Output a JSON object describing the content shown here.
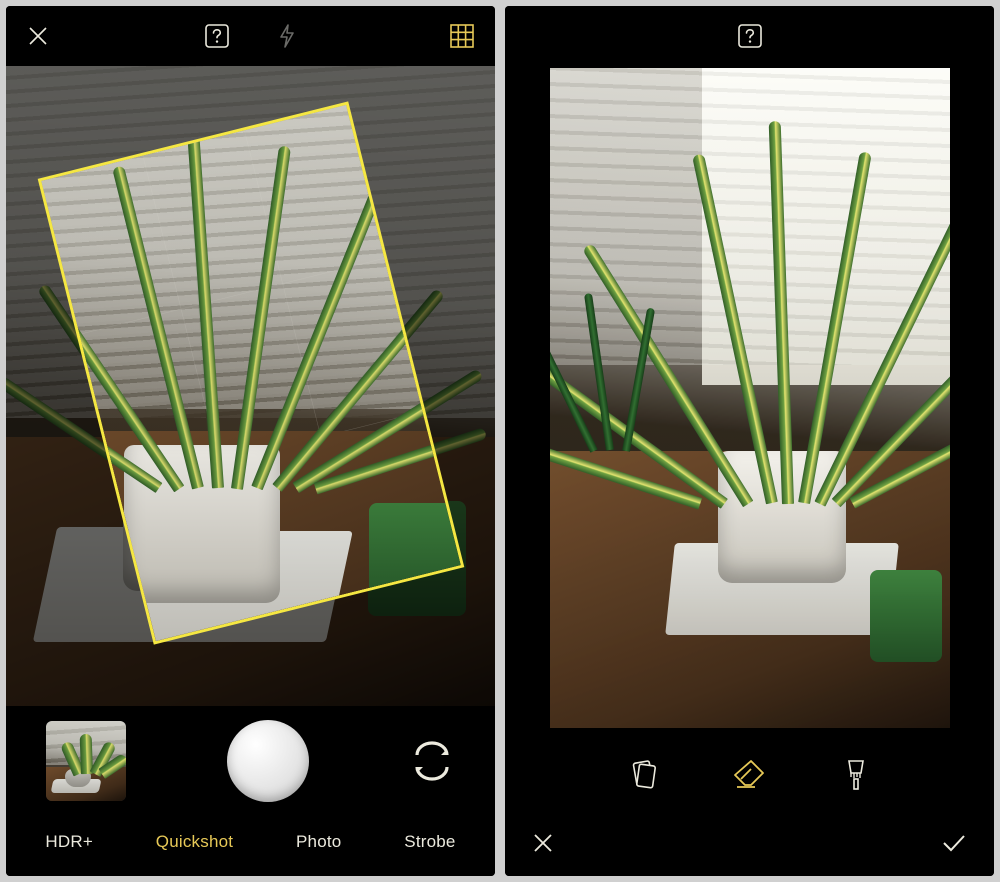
{
  "colors": {
    "accent": "#e7c957",
    "frame": "#f5e742",
    "text": "#eceade"
  },
  "left": {
    "icons": {
      "close": "close-icon",
      "help": "help-icon",
      "flash": "flash-icon",
      "grid": "grid-icon",
      "switch_camera": "switch-camera-icon"
    },
    "modes": [
      "HDR+",
      "Quickshot",
      "Photo",
      "Strobe"
    ],
    "active_mode_index": 1
  },
  "right": {
    "icons": {
      "help": "help-icon",
      "tool_stack": "card-stack-icon",
      "tool_eraser": "eraser-icon",
      "tool_brush": "brush-icon",
      "cancel": "close-icon",
      "confirm": "check-icon"
    },
    "active_tool_index": 1
  }
}
